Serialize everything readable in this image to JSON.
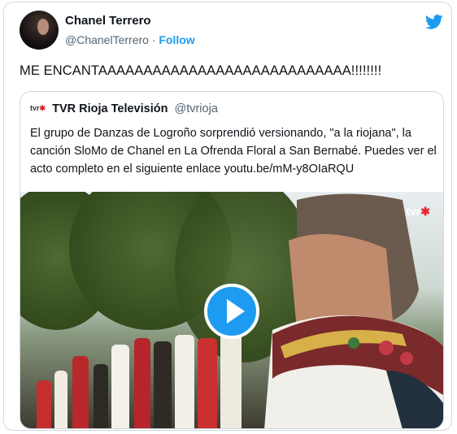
{
  "author": {
    "name": "Chanel Terrero",
    "handle": "@ChanelTerrero",
    "separator": "·",
    "follow_label": "Follow"
  },
  "tweet_text": "ME ENCANTAAAAAAAAAAAAAAAAAAAAAAAAAAAA!!!!!!!!",
  "quoted": {
    "logo_text": "tvr",
    "name": "TVR Rioja Televisión",
    "handle": "@tvrioja",
    "text_before_link": "El grupo de Danzas de Logroño sorprendió versionando, \"a la riojana\", la canción SloMo de Chanel en La Ofrenda Floral a San Bernabé.  Puedes ver el acto completo en el siguiente enlace ",
    "link": "youtu.be/mM-y8OIaRQU",
    "video_badge": "tvr"
  },
  "colors": {
    "accent": "#1d9bf0",
    "text": "#0f1419",
    "muted": "#536471",
    "border": "#cfd9de"
  },
  "icons": {
    "brand": "twitter-bird-icon",
    "play": "play-icon"
  }
}
